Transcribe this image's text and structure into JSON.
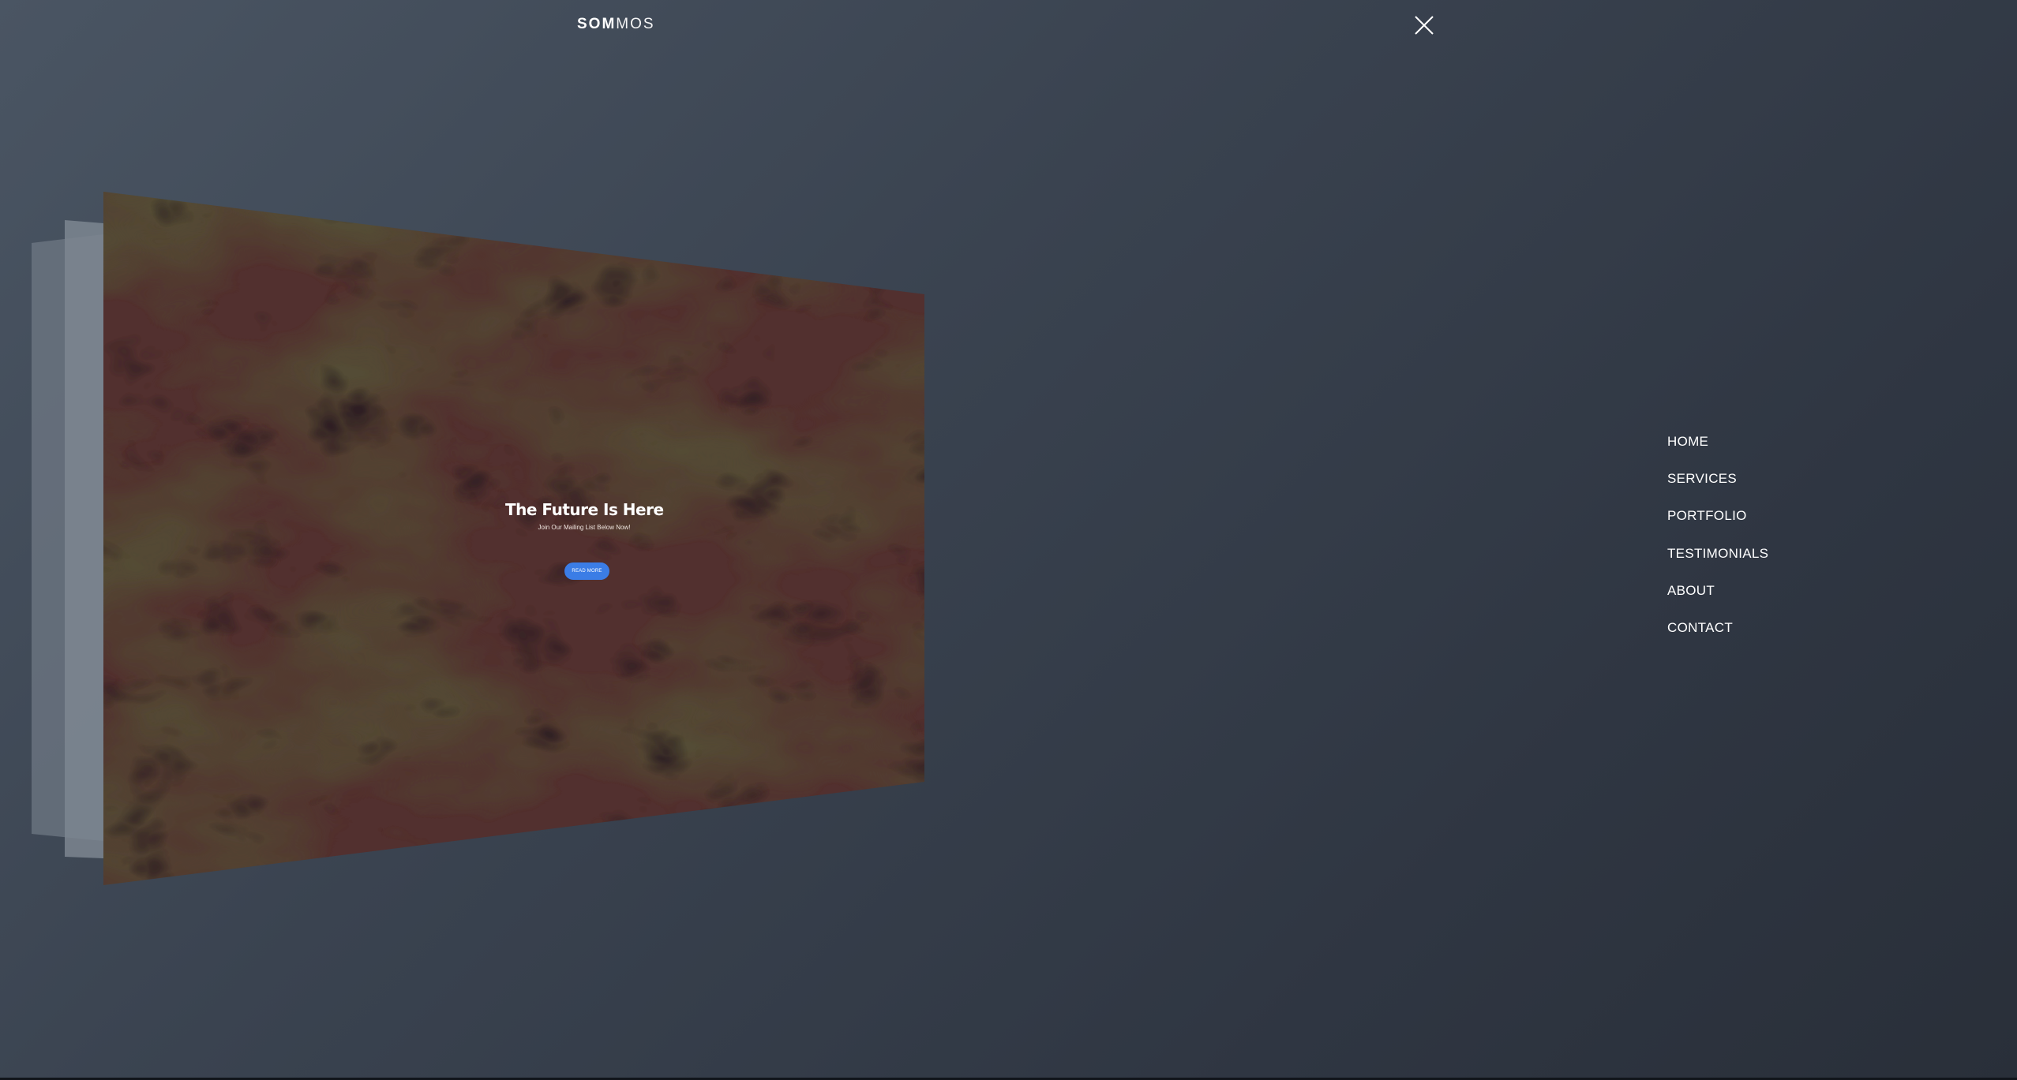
{
  "header": {
    "logo_bold": "SOM",
    "logo_light": "MOS",
    "close_icon": "close-icon"
  },
  "preview": {
    "title": "The Future Is Here",
    "subtitle": "Join Our Mailing List Below Now!",
    "button_label": "READ MORE",
    "background": "marbled-abstract-image",
    "accent": "#3b7de6"
  },
  "nav": {
    "items": [
      {
        "label": "HOME"
      },
      {
        "label": "SERVICES"
      },
      {
        "label": "PORTFOLIO"
      },
      {
        "label": "TESTIMONIALS"
      },
      {
        "label": "ABOUT"
      },
      {
        "label": "CONTACT"
      }
    ]
  }
}
